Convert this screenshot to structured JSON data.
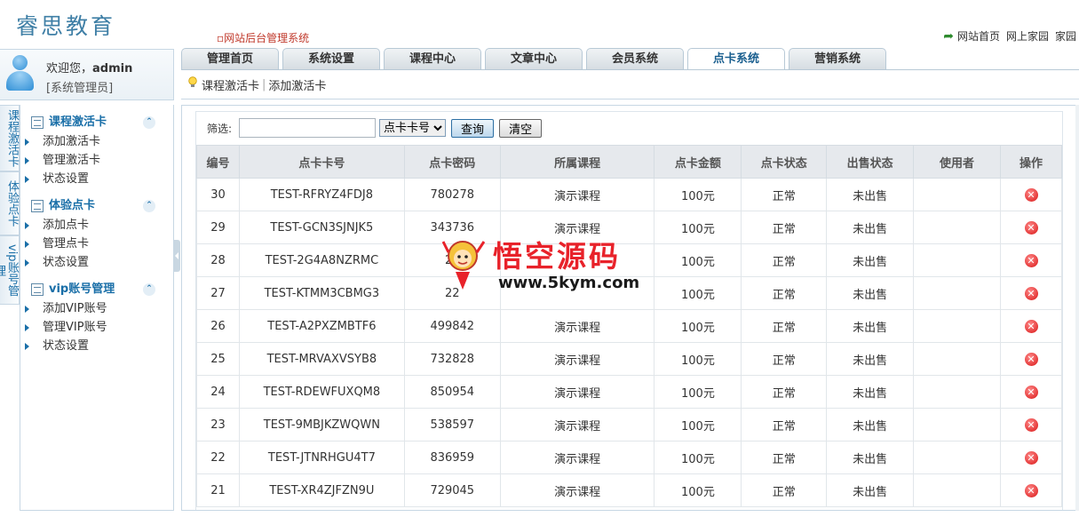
{
  "header": {
    "logo": "睿思教育",
    "system_title": "网站后台管理系统",
    "links": [
      "网站首页",
      "网上家园",
      "家园"
    ]
  },
  "user": {
    "welcome_prefix": "欢迎您，",
    "username": "admin",
    "role": "[系统管理员]"
  },
  "tabs": [
    {
      "label": "管理首页",
      "active": false
    },
    {
      "label": "系统设置",
      "active": false
    },
    {
      "label": "课程中心",
      "active": false
    },
    {
      "label": "文章中心",
      "active": false
    },
    {
      "label": "会员系统",
      "active": false
    },
    {
      "label": "点卡系统",
      "active": true
    },
    {
      "label": "营销系统",
      "active": false
    }
  ],
  "subnav": {
    "items": [
      "课程激活卡",
      "添加激活卡"
    ]
  },
  "vtabs": [
    "课程激活卡",
    "体验点卡",
    "vip账号管理"
  ],
  "sidebar": {
    "sections": [
      {
        "title": "课程激活卡",
        "items": [
          "添加激活卡",
          "管理激活卡",
          "状态设置"
        ]
      },
      {
        "title": "体验点卡",
        "items": [
          "添加点卡",
          "管理点卡",
          "状态设置"
        ]
      },
      {
        "title": "vip账号管理",
        "items": [
          "添加VIP账号",
          "管理VIP账号",
          "状态设置"
        ]
      }
    ]
  },
  "filter": {
    "label": "筛选:",
    "input_value": "",
    "select_value": "点卡卡号",
    "query_label": "查询",
    "clear_label": "清空"
  },
  "table": {
    "headers": [
      "编号",
      "点卡卡号",
      "点卡密码",
      "所属课程",
      "点卡金额",
      "点卡状态",
      "出售状态",
      "使用者",
      "操作"
    ],
    "rows": [
      [
        "30",
        "TEST-RFRYZ4FDJ8",
        "780278",
        "演示课程",
        "100元",
        "正常",
        "未出售",
        ""
      ],
      [
        "29",
        "TEST-GCN3SJNJK5",
        "343736",
        "演示课程",
        "100元",
        "正常",
        "未出售",
        ""
      ],
      [
        "28",
        "TEST-2G4A8NZRMC",
        "26",
        "",
        "100元",
        "正常",
        "未出售",
        ""
      ],
      [
        "27",
        "TEST-KTMM3CBMG3",
        "22",
        "",
        "100元",
        "正常",
        "未出售",
        ""
      ],
      [
        "26",
        "TEST-A2PXZMBTF6",
        "499842",
        "演示课程",
        "100元",
        "正常",
        "未出售",
        ""
      ],
      [
        "25",
        "TEST-MRVAXVSYB8",
        "732828",
        "演示课程",
        "100元",
        "正常",
        "未出售",
        ""
      ],
      [
        "24",
        "TEST-RDEWFUXQM8",
        "850954",
        "演示课程",
        "100元",
        "正常",
        "未出售",
        ""
      ],
      [
        "23",
        "TEST-9MBJKZWQWN",
        "538597",
        "演示课程",
        "100元",
        "正常",
        "未出售",
        ""
      ],
      [
        "22",
        "TEST-JTNRHGU4T7",
        "836959",
        "演示课程",
        "100元",
        "正常",
        "未出售",
        ""
      ],
      [
        "21",
        "TEST-XR4ZJFZN9U",
        "729045",
        "演示课程",
        "100元",
        "正常",
        "未出售",
        ""
      ]
    ]
  },
  "watermark": {
    "text": "悟空源码",
    "url": "www.5kym.com"
  },
  "colors": {
    "accent": "#1a6fa8",
    "delete": "#d91414",
    "header_bg": "#e6e9ed"
  }
}
